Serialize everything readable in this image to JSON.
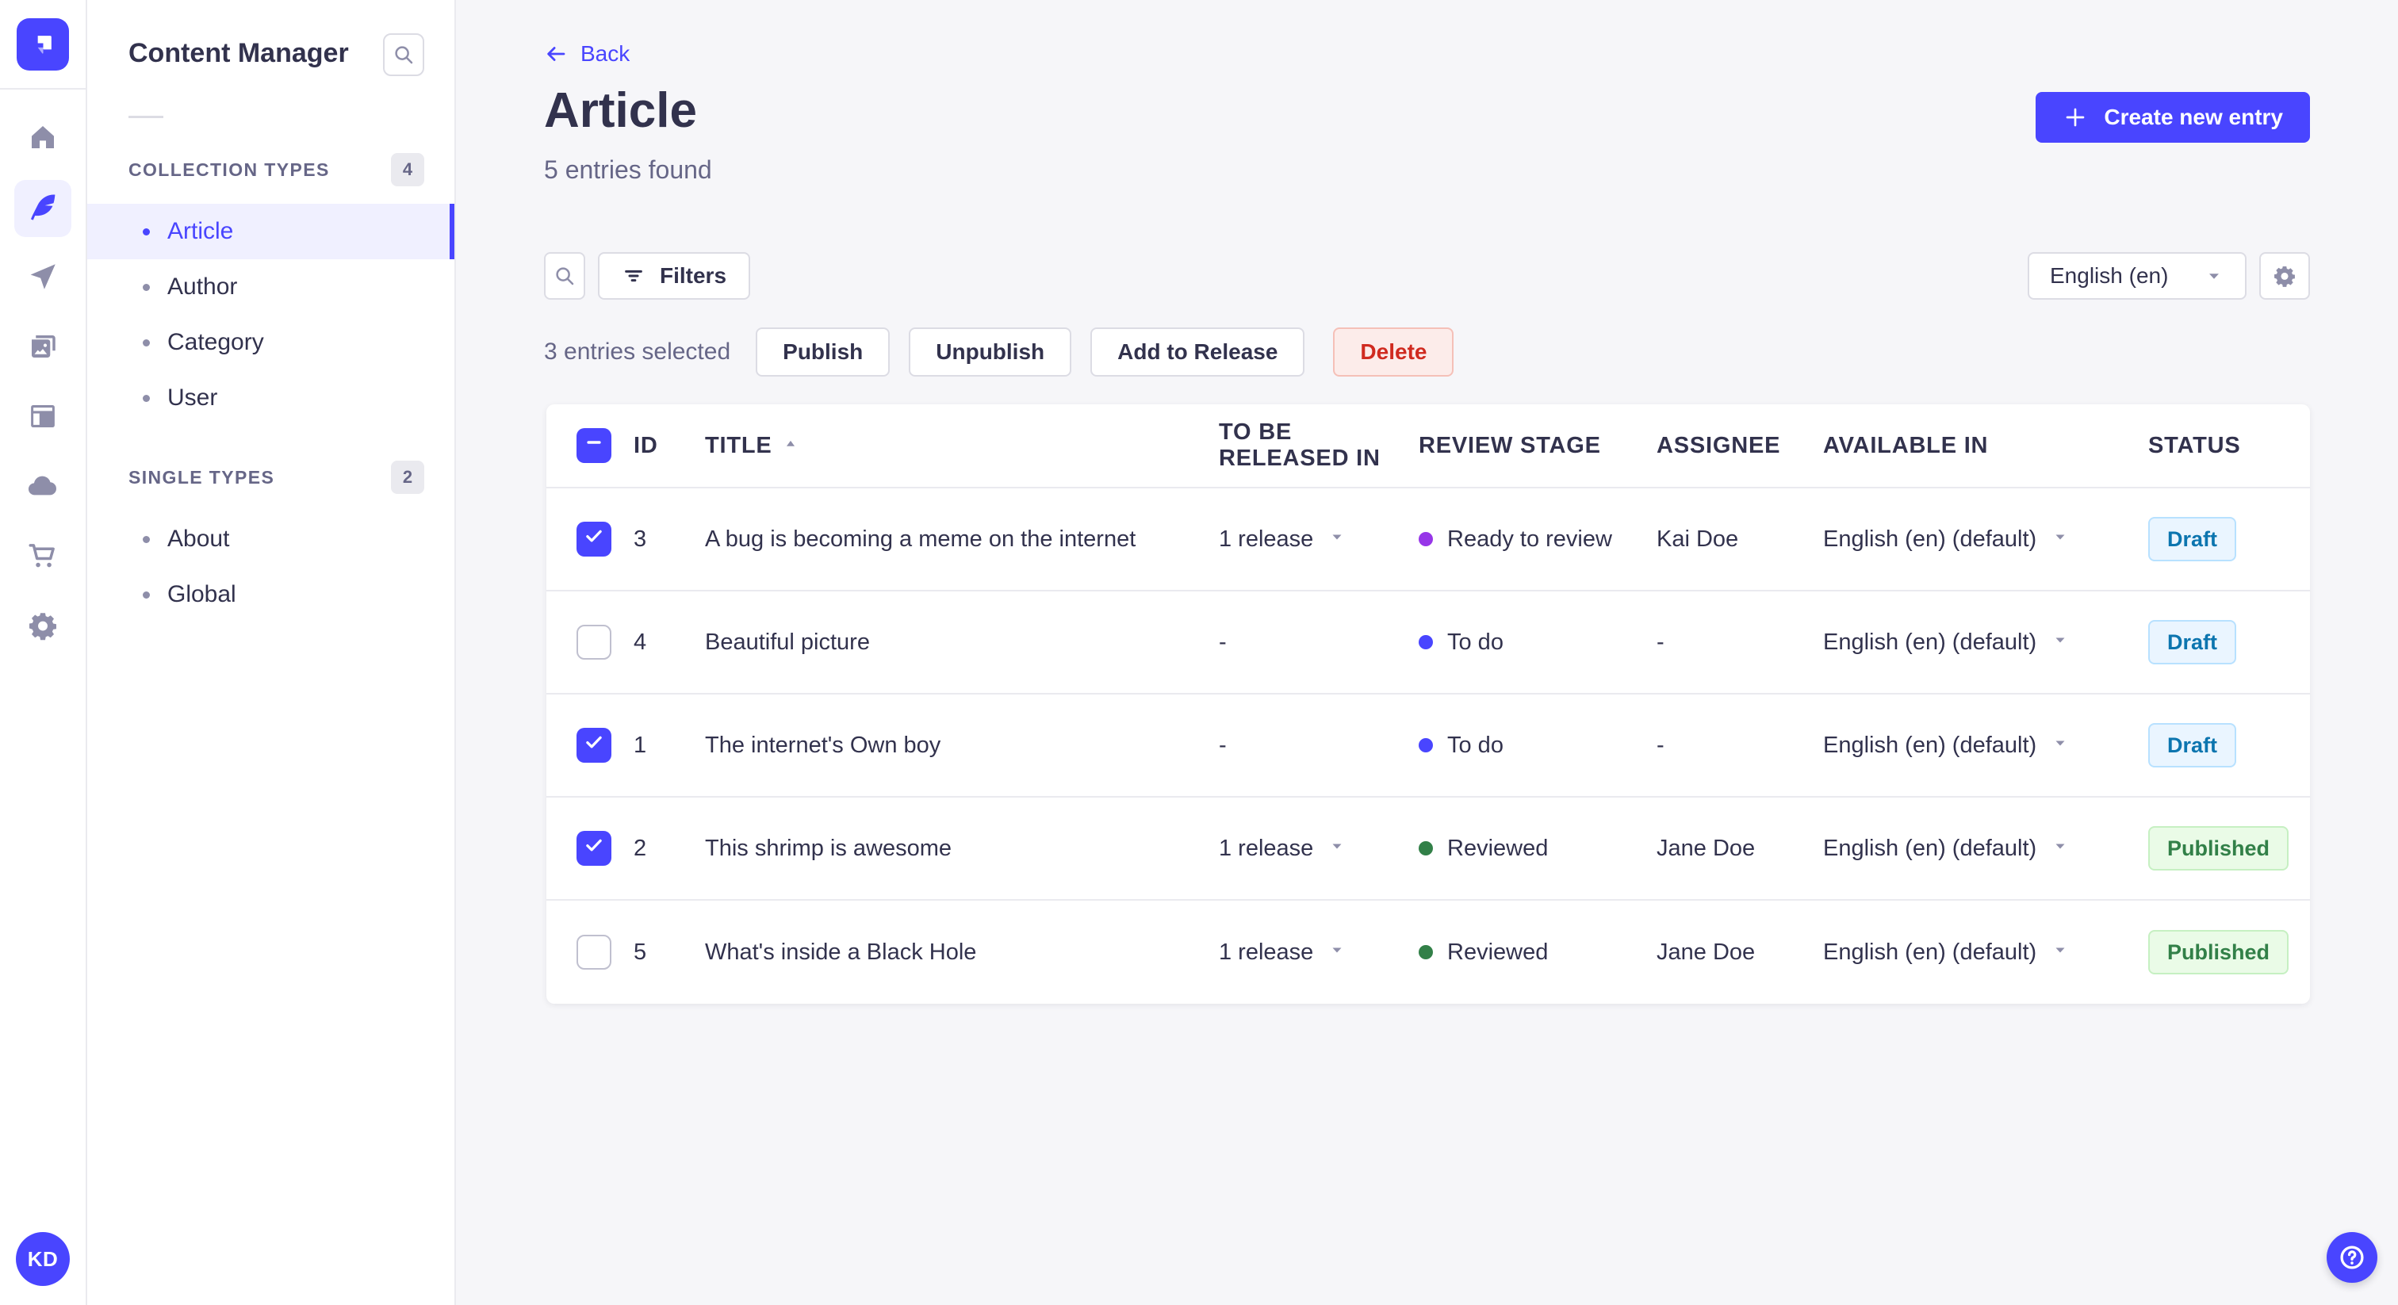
{
  "colors": {
    "primary": "#4945ff",
    "primary_light_bg": "#f0f0ff",
    "text": "#32324d",
    "muted": "#666687",
    "danger": "#d02b20",
    "stage_ready_to_review": "#9736e8",
    "stage_to_do": "#4945ff",
    "stage_reviewed": "#328048"
  },
  "rail": {
    "logo_icon": "strapi-logo",
    "items": [
      {
        "icon": "home-icon",
        "active": false
      },
      {
        "icon": "feather-icon",
        "active": true
      },
      {
        "icon": "paper-plane-icon",
        "active": false
      },
      {
        "icon": "media-icon",
        "active": false
      },
      {
        "icon": "layout-icon",
        "active": false
      },
      {
        "icon": "cloud-icon",
        "active": false
      },
      {
        "icon": "cart-icon",
        "active": false
      },
      {
        "icon": "gear-icon",
        "active": false
      }
    ],
    "avatar_initials": "KD",
    "help_icon": "question-mark-icon"
  },
  "subnav": {
    "title": "Content Manager",
    "search_icon": "search-icon",
    "sections": [
      {
        "label": "COLLECTION TYPES",
        "count": "4",
        "items": [
          {
            "label": "Article",
            "active": true
          },
          {
            "label": "Author",
            "active": false
          },
          {
            "label": "Category",
            "active": false
          },
          {
            "label": "User",
            "active": false
          }
        ]
      },
      {
        "label": "SINGLE TYPES",
        "count": "2",
        "items": [
          {
            "label": "About",
            "active": false
          },
          {
            "label": "Global",
            "active": false
          }
        ]
      }
    ]
  },
  "header": {
    "back_label": "Back",
    "back_icon": "arrow-left-icon",
    "title": "Article",
    "subtitle": "5 entries found",
    "create_label": "Create new entry",
    "create_icon": "plus-icon"
  },
  "toolbar": {
    "search_icon": "search-icon",
    "filters_icon": "filter-icon",
    "filters_label": "Filters",
    "locale_value": "English (en)",
    "locale_chevron_icon": "chevron-down-icon",
    "settings_icon": "gear-icon"
  },
  "selection": {
    "count_text": "3 entries selected",
    "actions": [
      {
        "label": "Publish",
        "variant": "default"
      },
      {
        "label": "Unpublish",
        "variant": "default"
      },
      {
        "label": "Add to Release",
        "variant": "default"
      },
      {
        "label": "Delete",
        "variant": "danger"
      }
    ]
  },
  "table": {
    "header_checkbox_state": "indeterminate",
    "sort_column": "TITLE",
    "sort_direction": "asc",
    "sort_icon": "sort-asc-icon",
    "columns": [
      "ID",
      "TITLE",
      "TO BE RELEASED IN",
      "REVIEW STAGE",
      "ASSIGNEE",
      "AVAILABLE IN",
      "STATUS"
    ],
    "rows": [
      {
        "checked": true,
        "id": "3",
        "title": "A bug is becoming a meme on the internet",
        "release": "1 release",
        "release_dropdown": true,
        "stage": "Ready to review",
        "stage_color": "#9736e8",
        "assignee": "Kai Doe",
        "locale": "English (en) (default)",
        "status": "Draft"
      },
      {
        "checked": false,
        "id": "4",
        "title": "Beautiful picture",
        "release": "-",
        "release_dropdown": false,
        "stage": "To do",
        "stage_color": "#4945ff",
        "assignee": "-",
        "locale": "English (en) (default)",
        "status": "Draft"
      },
      {
        "checked": true,
        "id": "1",
        "title": "The internet's Own boy",
        "release": "-",
        "release_dropdown": false,
        "stage": "To do",
        "stage_color": "#4945ff",
        "assignee": "-",
        "locale": "English (en) (default)",
        "status": "Draft"
      },
      {
        "checked": true,
        "id": "2",
        "title": "This shrimp is awesome",
        "release": "1 release",
        "release_dropdown": true,
        "stage": "Reviewed",
        "stage_color": "#328048",
        "assignee": "Jane Doe",
        "locale": "English (en) (default)",
        "status": "Published"
      },
      {
        "checked": false,
        "id": "5",
        "title": "What's inside a Black Hole",
        "release": "1 release",
        "release_dropdown": true,
        "stage": "Reviewed",
        "stage_color": "#328048",
        "assignee": "Jane Doe",
        "locale": "English (en) (default)",
        "status": "Published"
      }
    ]
  }
}
